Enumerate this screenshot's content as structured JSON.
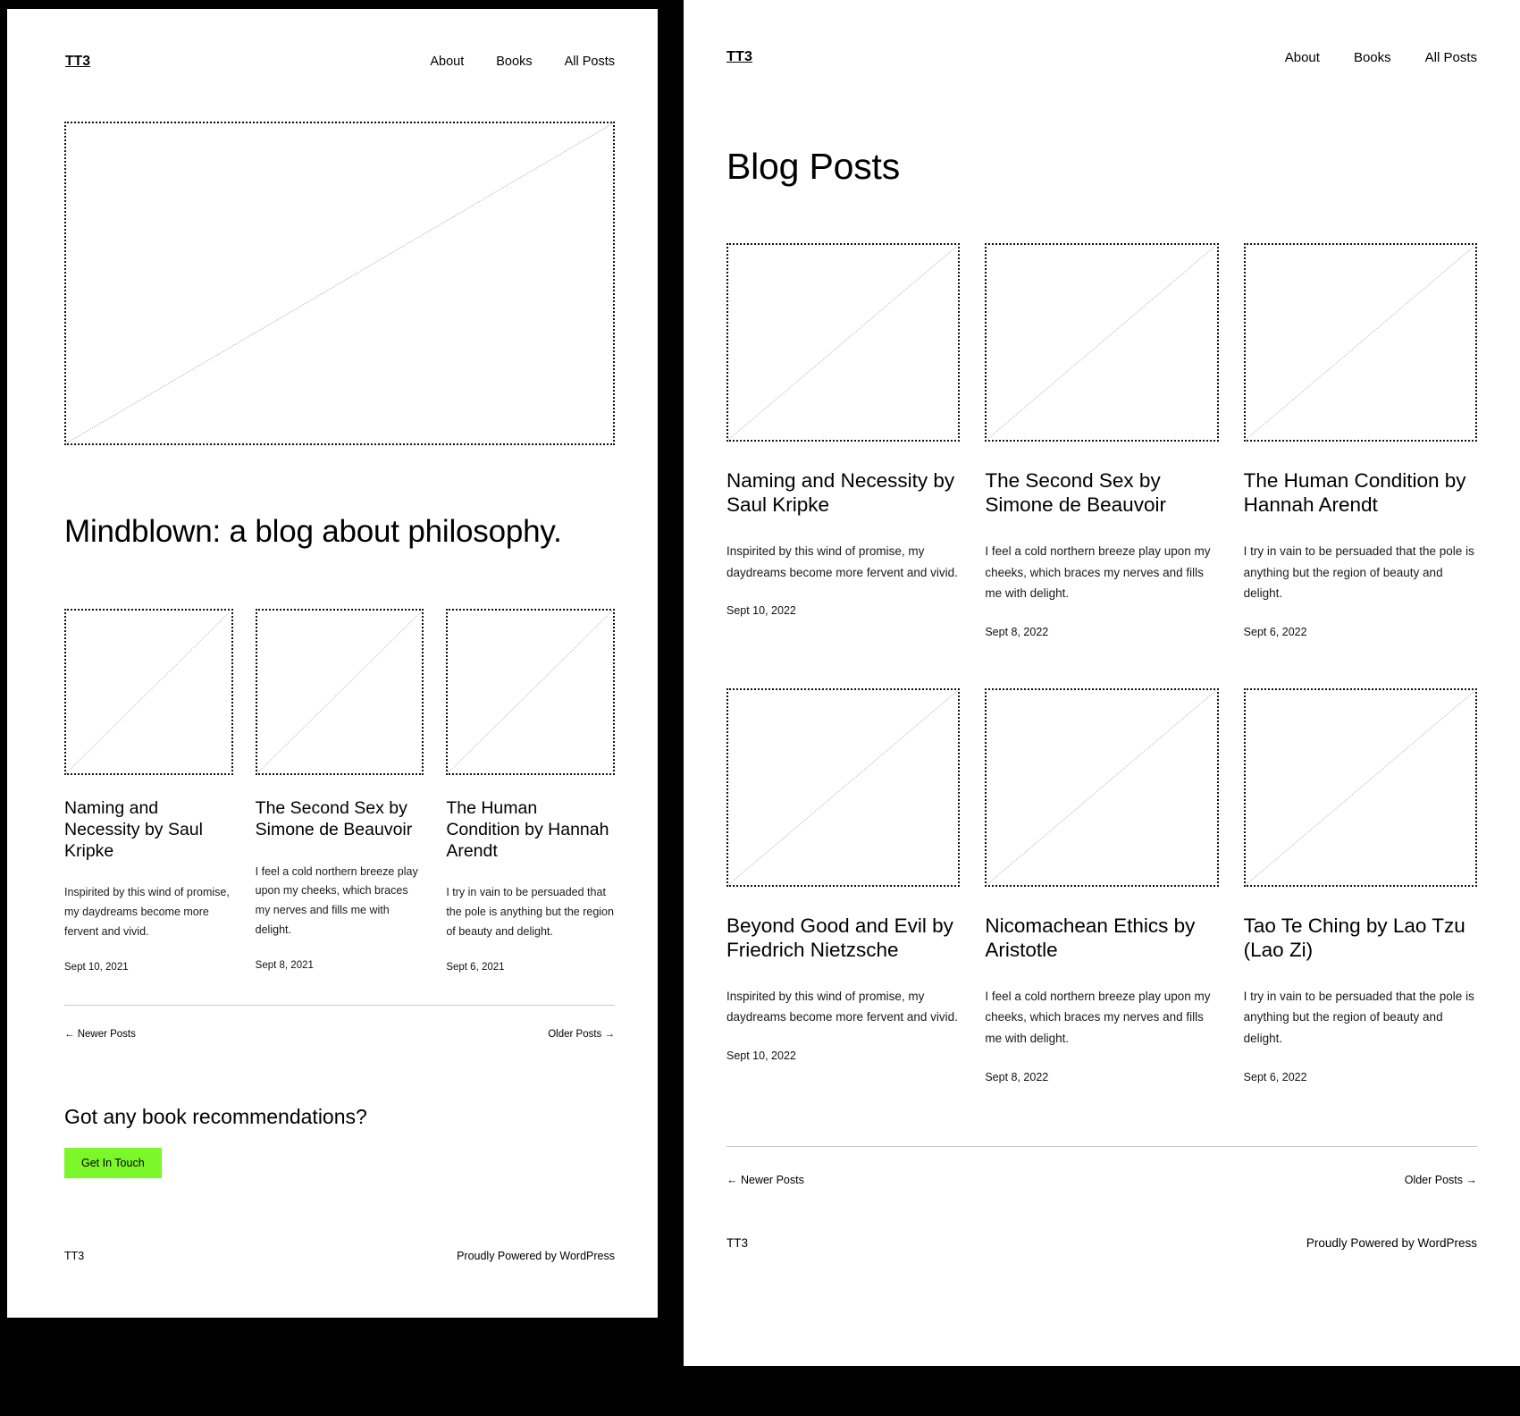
{
  "theme": {
    "accent_green": "#7CF72A",
    "background": "#000000",
    "page_background": "#FFFFFF",
    "text": "#000000"
  },
  "left_page": {
    "header": {
      "brand": "TT3",
      "nav": [
        {
          "label": "About"
        },
        {
          "label": "Books"
        },
        {
          "label": "All Posts"
        }
      ]
    },
    "hero": {
      "image_alt": "hero-placeholder",
      "title": "Mindblown: a blog about philosophy."
    },
    "posts": [
      {
        "title": "Naming and Necessity by Saul Kripke",
        "excerpt": "Inspirited by this wind of promise, my daydreams become more fervent and vivid.",
        "date": "Sept 10, 2021"
      },
      {
        "title": "The Second Sex by Simone de Beauvoir",
        "excerpt": "I feel a cold northern breeze play upon my cheeks, which braces my nerves and fills me with delight.",
        "date": "Sept 8, 2021"
      },
      {
        "title": "The Human Condition by Hannah Arendt",
        "excerpt": "I try in vain to be persuaded that the pole is anything but the region of beauty and delight.",
        "date": "Sept 6, 2021"
      }
    ],
    "pagination": {
      "newer": "← Newer Posts",
      "older": "Older Posts →"
    },
    "cta": {
      "title": "Got any book recommendations?",
      "button": "Get In Touch"
    },
    "footer": {
      "brand": "TT3",
      "credit": "Proudly Powered by WordPress"
    }
  },
  "right_page": {
    "header": {
      "brand": "TT3",
      "nav": [
        {
          "label": "About"
        },
        {
          "label": "Books"
        },
        {
          "label": "All Posts"
        }
      ]
    },
    "heading": "Blog Posts",
    "posts": [
      {
        "title": "Naming and Necessity by Saul Kripke",
        "excerpt": "Inspirited by this wind of promise, my daydreams become more fervent and vivid.",
        "date": "Sept 10, 2022"
      },
      {
        "title": "The Second Sex by Simone de Beauvoir",
        "excerpt": "I feel a cold northern breeze play upon my cheeks, which braces my nerves and fills me with delight.",
        "date": "Sept 8, 2022"
      },
      {
        "title": "The Human Condition by Hannah Arendt",
        "excerpt": "I try in vain to be persuaded that the pole is anything but the region of beauty and delight.",
        "date": "Sept 6, 2022"
      },
      {
        "title": "Beyond Good and Evil by Friedrich Nietzsche",
        "excerpt": "Inspirited by this wind of promise, my daydreams become more fervent and vivid.",
        "date": "Sept 10, 2022"
      },
      {
        "title": "Nicomachean Ethics by Aristotle",
        "excerpt": "I feel a cold northern breeze play upon my cheeks, which braces my nerves and fills me with delight.",
        "date": "Sept 8, 2022"
      },
      {
        "title": "Tao Te Ching by Lao Tzu (Lao Zi)",
        "excerpt": "I try in vain to be persuaded that the pole is anything but the region of beauty and delight.",
        "date": "Sept 6, 2022"
      }
    ],
    "pagination": {
      "newer": "← Newer Posts",
      "older": "Older Posts →"
    },
    "footer": {
      "brand": "TT3",
      "credit": "Proudly Powered by WordPress"
    }
  }
}
